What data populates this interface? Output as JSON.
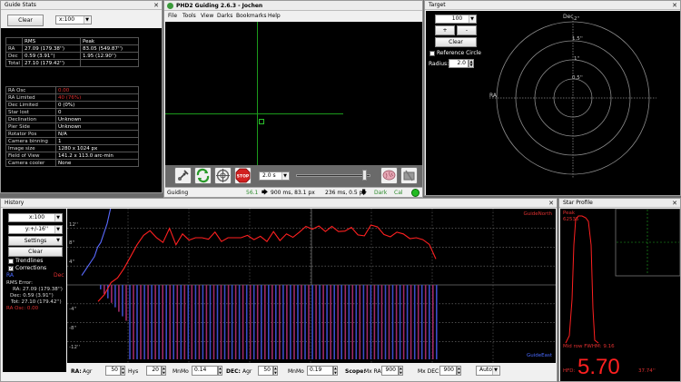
{
  "guide_stats": {
    "title": "Guide Stats",
    "clear_label": "Clear",
    "scale": "x:100",
    "rms_header": "RMS",
    "peak_header": "Peak",
    "rows": [
      {
        "label": "RA",
        "rms": "27.09 (179.38'')",
        "peak": "83.05 (549.87'')"
      },
      {
        "label": "Dec",
        "rms": "0.59 (3.91'')",
        "peak": "1.95 (12.90'')"
      },
      {
        "label": "Total",
        "rms": "27.10 (179.42'')",
        "peak": ""
      }
    ],
    "info": [
      {
        "k": "RA Osc",
        "v": "0.00"
      },
      {
        "k": "RA Limited",
        "v": "40 (76%)"
      },
      {
        "k": "Dec Limited",
        "v": "0 (0%)"
      },
      {
        "k": "Star lost",
        "v": "0"
      },
      {
        "k": "Declination",
        "v": "Unknown"
      },
      {
        "k": "Pier Side",
        "v": "Unknown"
      },
      {
        "k": "Rotator Pos",
        "v": "N/A"
      },
      {
        "k": "Camera binning",
        "v": "1"
      },
      {
        "k": "Image size",
        "v": "1280 x 1024 px"
      },
      {
        "k": "Field of View",
        "v": "141.2 x 113.0 arc-min"
      },
      {
        "k": "Camera cooler",
        "v": "None"
      }
    ]
  },
  "main_window": {
    "title": "PHD2 Guiding 2.6.3 - Jochen",
    "menu": [
      "File",
      "Tools",
      "View",
      "Darks",
      "Bookmarks",
      "Help"
    ],
    "exposure": "2.0 s",
    "status": {
      "mode": "Guiding",
      "snr": "56.1",
      "ra_pulse": "900 ms, 83.1 px",
      "dec_pulse": "236 ms, 0.5 px",
      "dark": "Dark",
      "cal": "Cal"
    }
  },
  "target": {
    "title": "Target",
    "scale": "100",
    "plus": "+",
    "minus": "-",
    "clear_label": "Clear",
    "ref_circle_label": "Reference Circle",
    "radius_label": "Radius:",
    "radius_value": "2.0",
    "axis_dec": "Dec",
    "axis_ra": "RA",
    "ring_labels": [
      "2''",
      "1.5''",
      "1''",
      "0.5''"
    ]
  },
  "history": {
    "title": "History",
    "x_scale": "x:100",
    "y_scale": "y:+/-16''",
    "settings_label": "Settings",
    "clear_label": "Clear",
    "trendlines_label": "Trendlines",
    "corrections_label": "Corrections",
    "ra_label": "RA",
    "dec_label": "Dec",
    "rms_title": "RMS Error:",
    "rms_lines": [
      "RA: 27.09 (179.38'')",
      "Dec: 0.59 (3.91'')",
      "Tot: 27.10 (179.42'')"
    ],
    "ra_osc": "RA Osc: 0.00",
    "guide_north": "GuideNorth",
    "guide_east": "GuideEast",
    "y_ticks": [
      "12''",
      "8''",
      "4''",
      "-4''",
      "-8''",
      "-12''"
    ],
    "ra_series": [
      2,
      3,
      4,
      5,
      6,
      8,
      9,
      11,
      13,
      16,
      19,
      22,
      26,
      30,
      34,
      38,
      40,
      40,
      40,
      40,
      40,
      40,
      40,
      40,
      40
    ],
    "dec_series": [
      -3.5,
      -2,
      0.5,
      1.5,
      3.5,
      6,
      8.5,
      10.5,
      11.5,
      10,
      9,
      12,
      8.5,
      10.8,
      9.5,
      10,
      10,
      9.7,
      11.2,
      9.2,
      10,
      10,
      10,
      10.5,
      9.6,
      10.3,
      9.2,
      11.3,
      9.4,
      10.8,
      10.1,
      11.2,
      12.4,
      11.8,
      12.5,
      11.3,
      12.4,
      11.3,
      11.4,
      12.2,
      10.6,
      10.4,
      12.7,
      12.3,
      10.7,
      10.2,
      11.2,
      10.8,
      9.8,
      10,
      9.6,
      8.6,
      5.5
    ]
  },
  "bottom_bar": {
    "ra_label": "RA:",
    "agr_label": "Agr",
    "agr_value": "50",
    "hys_label": "Hys",
    "hys_value": "20",
    "mnmo_label": "MnMo",
    "mnmo_value": "0.14",
    "dec_label": "DEC:",
    "dec_agr_label": "Agr",
    "dec_agr_value": "50",
    "dec_mnmo_label": "MnMo",
    "dec_mnmo_value": "0.19",
    "scope_label": "Scope:",
    "mx_ra_label": "Mx RA",
    "mx_ra_value": "900",
    "mx_dec_label": "Mx DEC",
    "mx_dec_value": "900",
    "dec_mode": "Auto"
  },
  "star_profile": {
    "title": "Star Profile",
    "peak_label": "Peak",
    "peak_value": "62535",
    "mid_row_label": "Mid row FWHM: 9.16",
    "hfd_label": "HFD:",
    "hfd_value": "5.70",
    "hfd_arcsec": "37.74''"
  }
}
